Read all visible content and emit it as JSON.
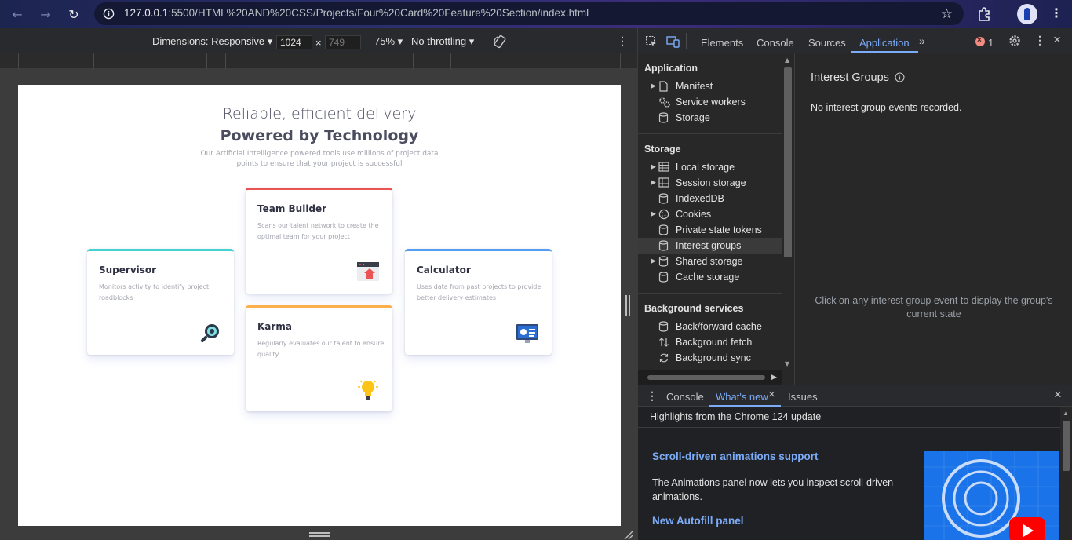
{
  "browser": {
    "url_host": "127.0.0.1",
    "url_path": ":5500/HTML%20AND%20CSS/Projects/Four%20Card%20Feature%20Section/index.html"
  },
  "device_toolbar": {
    "dimensions_label": "Dimensions: Responsive",
    "width_value": "1024",
    "height_value": "749",
    "times": "×",
    "zoom": "75%",
    "throttling": "No throttling"
  },
  "page": {
    "heading_light": "Reliable, efficient delivery",
    "heading_bold": "Powered by Technology",
    "description": "Our Artificial Intelligence powered tools use millions of project data points to ensure that your project is successful",
    "cards": [
      {
        "title": "Supervisor",
        "description": "Monitors activity to identify project roadblocks",
        "accent": "#44d3d2",
        "icon": "magnifier-icon"
      },
      {
        "title": "Team Builder",
        "description": "Scans our talent network to create the optimal team for your project",
        "accent": "#ea5454",
        "icon": "team-builder-icon"
      },
      {
        "title": "Karma",
        "description": "Regularly evaluates our talent to ensure quality",
        "accent": "#fcaf4a",
        "icon": "lightbulb-icon"
      },
      {
        "title": "Calculator",
        "description": "Uses data from past projects to provide better delivery estimates",
        "accent": "#549ef2",
        "icon": "calculator-icon"
      }
    ]
  },
  "devtools": {
    "tabs": [
      "Elements",
      "Console",
      "Sources",
      "Application"
    ],
    "active_tab": "Application",
    "error_count": "1",
    "sidebar": {
      "application_header": "Application",
      "application_items": [
        "Manifest",
        "Service workers",
        "Storage"
      ],
      "storage_header": "Storage",
      "storage_items": [
        "Local storage",
        "Session storage",
        "IndexedDB",
        "Cookies",
        "Private state tokens",
        "Interest groups",
        "Shared storage",
        "Cache storage"
      ],
      "background_header": "Background services",
      "background_items": [
        "Back/forward cache",
        "Background fetch",
        "Background sync"
      ]
    },
    "main": {
      "title": "Interest Groups",
      "empty_message": "No interest group events recorded.",
      "hint": "Click on any interest group event to display the group's current state"
    },
    "drawer": {
      "tabs": [
        "Console",
        "What's new",
        "Issues"
      ],
      "active_tab": "What's new",
      "highlights": "Highlights from the Chrome 124 update",
      "feature1_title": "Scroll-driven animations support",
      "feature1_desc": "The Animations panel now lets you inspect scroll-driven animations.",
      "feature2_title": "New Autofill panel"
    }
  },
  "colors": {
    "link_blue": "#7cacf8",
    "active_tab": "#7cacf8",
    "error_red": "#f28b82"
  }
}
